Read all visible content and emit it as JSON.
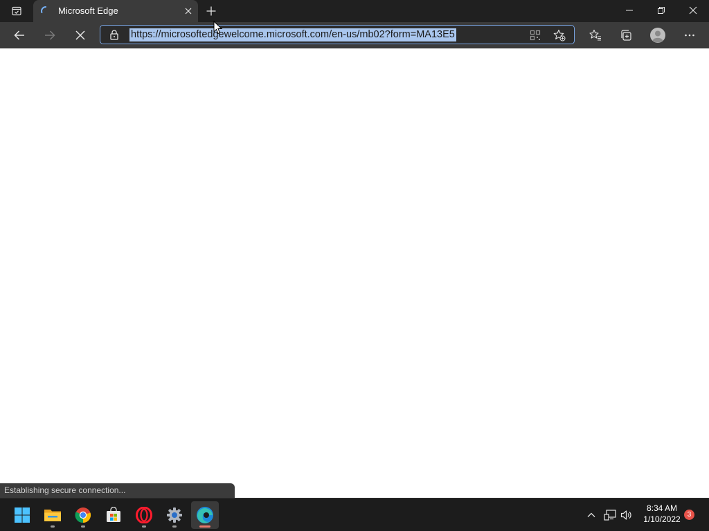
{
  "browser": {
    "tab": {
      "title": "Microsoft Edge"
    },
    "address_bar": {
      "url": "https://microsoftedgewelcome.microsoft.com/en-us/mb02?form=MA13E5"
    },
    "status_text": "Establishing secure connection...",
    "icons": {
      "tab_actions": "tab-actions-icon",
      "spinner": "loading-spinner-icon",
      "close_tab": "close-icon",
      "new_tab": "plus-icon",
      "minimize": "minimize-icon",
      "restore": "restore-icon",
      "close_window": "close-icon",
      "back": "arrow-left-icon",
      "forward": "arrow-right-icon",
      "stop": "stop-loading-icon",
      "lock": "lock-icon",
      "qr": "qr-code-icon",
      "add_favorite": "star-add-icon",
      "favorites": "favorites-icon",
      "collections": "collections-icon",
      "profile": "profile-avatar-icon",
      "more": "more-options-icon"
    }
  },
  "taskbar": {
    "apps": [
      "start",
      "file-explorer",
      "chrome",
      "microsoft-store",
      "opera",
      "settings",
      "edge"
    ],
    "tray": [
      "chevron-up-icon",
      "network-icon",
      "volume-icon"
    ],
    "clock": {
      "time": "8:34 AM",
      "date": "1/10/2022"
    },
    "notification_count": "3"
  },
  "colors": {
    "titlebar": "#202020",
    "toolbar": "#3b3b3b",
    "url_selection": "#a9c6ee",
    "address_focus": "#7aa7e6",
    "taskbar": "#1c1c1c",
    "badge": "#e8534a"
  }
}
